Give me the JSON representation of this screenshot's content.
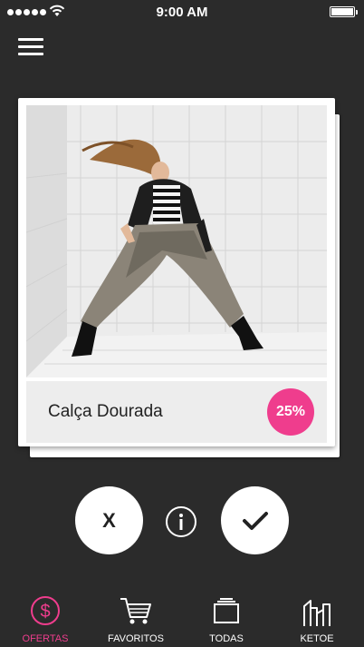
{
  "status_bar": {
    "time": "9:00 AM"
  },
  "card": {
    "product_name": "Calça Dourada",
    "discount": "25%",
    "image_alt": "Model in sequined pants and studded jacket in a white padded room"
  },
  "actions": {
    "reject_label": "X"
  },
  "tabs": [
    {
      "label": "OFERTAS",
      "icon": "dollar-icon",
      "active": true
    },
    {
      "label": "FAVORITOS",
      "icon": "cart-icon",
      "active": false
    },
    {
      "label": "TODAS",
      "icon": "stack-icon",
      "active": false
    },
    {
      "label": "KETOE",
      "icon": "city-icon",
      "active": false
    }
  ],
  "colors": {
    "accent": "#ef3d8d",
    "background": "#2b2b2b"
  }
}
